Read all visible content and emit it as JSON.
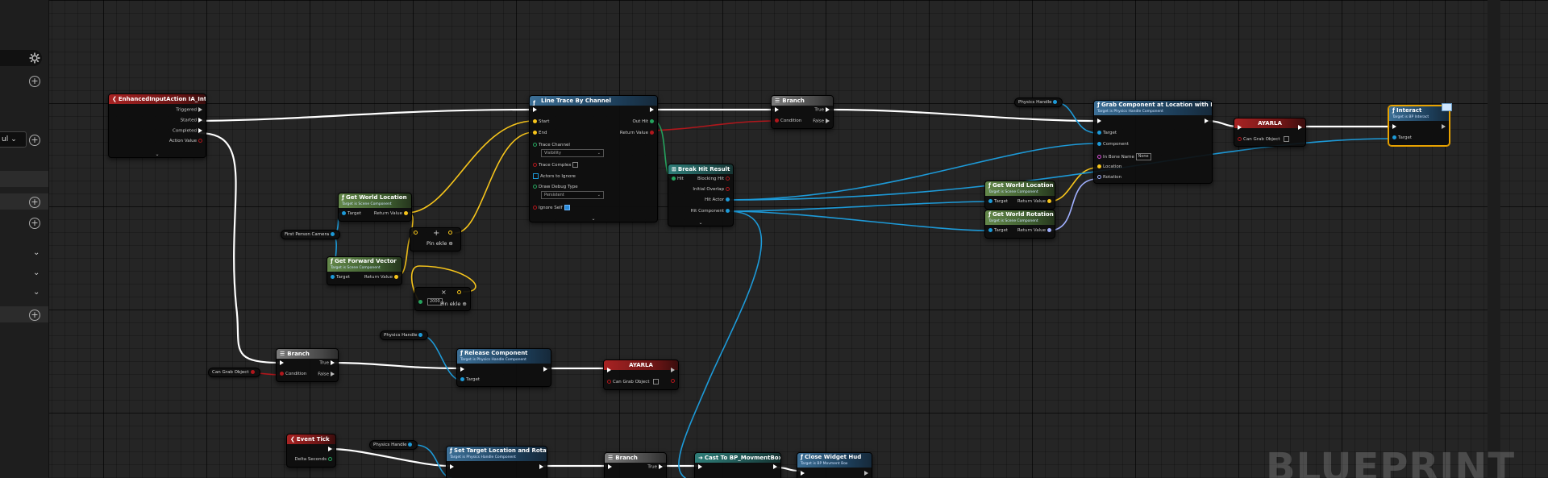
{
  "colors": {
    "exec": "#ffffff",
    "object": "#1d9ad8",
    "bool": "#b0171c",
    "vector": "#f7c51b",
    "rotator": "#a0b0ff",
    "struct": "#25a35e",
    "string": "#d64fd6",
    "selected": "#e8a200"
  },
  "side_panel": {
    "combo_value": "ul",
    "icons": [
      "gear-icon",
      "plus-icon",
      "chevron-down-icon"
    ]
  },
  "watermark": "BLUEPRINT",
  "nodes": {
    "enhanced_input": {
      "title": "EnhancedInputAction IA_Interact",
      "pins": [
        "Triggered",
        "Started",
        "Completed",
        "Action Value"
      ]
    },
    "line_trace": {
      "title": "Line Trace By Channel",
      "pins": {
        "start": "Start",
        "end": "End",
        "out_hit": "Out Hit",
        "return": "Return Value",
        "trace_channel": "Trace Channel",
        "trace_channel_value": "Visibility",
        "trace_complex": "Trace Complex",
        "actors_to_ignore": "Actors to Ignore",
        "draw_debug": "Draw Debug Type",
        "draw_debug_value": "Persistent",
        "ignore_self": "Ignore Self"
      }
    },
    "branch1": {
      "title": "Branch",
      "true": "True",
      "false": "False",
      "condition": "Condition"
    },
    "physics_handle_1": "Physics Handle",
    "grab": {
      "title": "Grab Component at Location with Rotation",
      "subtitle": "Target is Physics Handle Component",
      "pins": {
        "target": "Target",
        "component": "Component",
        "bone": "In Bone Name",
        "bone_value": "None",
        "location": "Location",
        "rotation": "Rotation"
      }
    },
    "ayarla1": {
      "title": "AYARLA",
      "pin": "Can Grab Object"
    },
    "interact": {
      "title": "Interact",
      "subtitle": "Target is BP Interact",
      "pin": "Target"
    },
    "break_hit": {
      "title": "Break Hit Result",
      "pins": {
        "hit": "Hit",
        "blocking": "Blocking Hit",
        "initial": "Initial Overlap",
        "hit_actor": "Hit Actor",
        "hit_component": "Hit Component"
      }
    },
    "gwl_top": {
      "title": "Get World Location",
      "subtitle": "Target is Scene Component",
      "target": "Target",
      "ret": "Return Value"
    },
    "gwl_right": {
      "title": "Get World Location",
      "subtitle": "Target is Scene Component",
      "target": "Target",
      "ret": "Return Value"
    },
    "gwr_right": {
      "title": "Get World Rotation",
      "subtitle": "Target is Scene Component",
      "target": "Target",
      "ret": "Return Value"
    },
    "first_person_camera": "First Person Camera",
    "forward": {
      "title": "Get Forward Vector",
      "subtitle": "Target is Scene Component",
      "target": "Target",
      "ret": "Return Value"
    },
    "pin_add": "Pin ekle",
    "multiply_value": "2000",
    "branch2": {
      "title": "Branch",
      "true": "True",
      "false": "False",
      "condition": "Condition"
    },
    "can_grab_object": "Can Grab Object",
    "physics_handle_2": "Physics Handle",
    "release": {
      "title": "Release Component",
      "subtitle": "Target is Physics Handle Component",
      "target": "Target"
    },
    "ayarla2": {
      "title": "AYARLA",
      "pin": "Can Grab Object"
    },
    "event_tick": {
      "title": "Event Tick",
      "pin": "Delta Seconds"
    },
    "physics_handle_3": "Physics Handle",
    "set_target": {
      "title": "Set Target Location and Rotation",
      "subtitle": "Target is Physics Handle Component"
    },
    "branch3": {
      "title": "Branch",
      "true": "True"
    },
    "cast": {
      "title": "Cast To BP_MovmentBox"
    },
    "close_widget": {
      "title": "Close Widget Hud",
      "subtitle": "Target is BP Movment Box"
    }
  }
}
